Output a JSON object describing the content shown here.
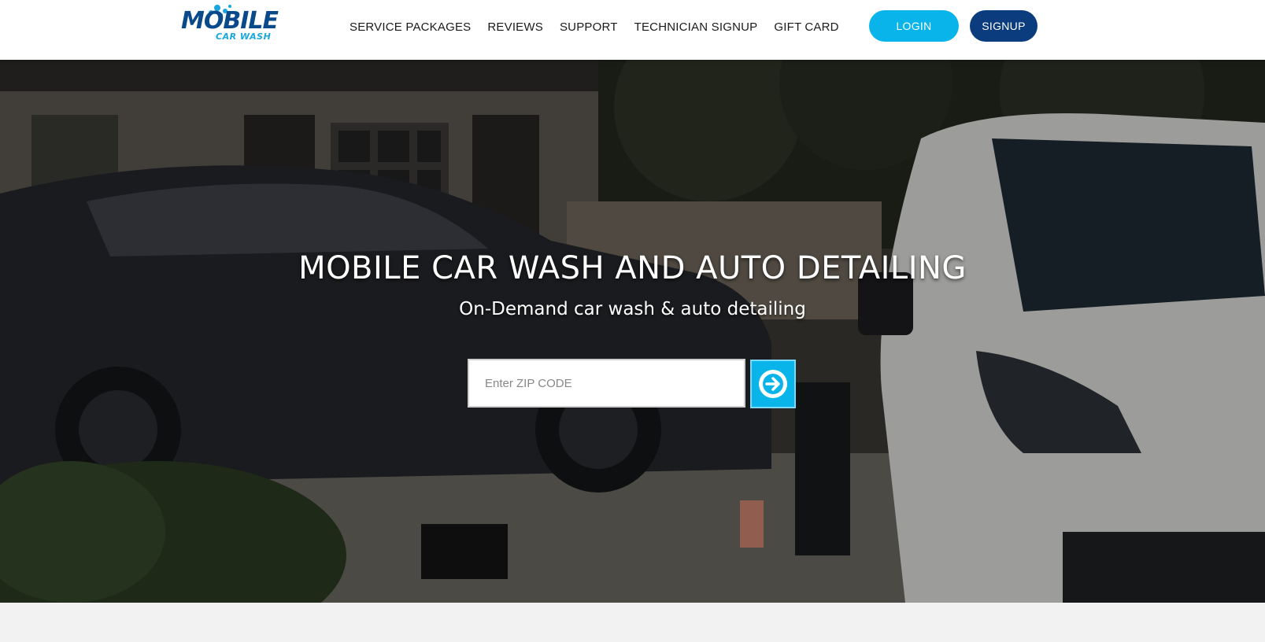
{
  "logo": {
    "word": "MOBILE",
    "sub": "CAR WASH"
  },
  "nav": {
    "items": [
      {
        "label": "SERVICE PACKAGES"
      },
      {
        "label": "REVIEWS"
      },
      {
        "label": "SUPPORT"
      },
      {
        "label": "TECHNICIAN SIGNUP"
      },
      {
        "label": "GIFT CARD"
      }
    ]
  },
  "auth": {
    "login_label": "LOGIN",
    "signup_label": "SIGNUP"
  },
  "hero": {
    "title": "MOBILE CAR WASH AND AUTO DETAILING",
    "subtitle": "On-Demand car wash & auto detailing",
    "zip_placeholder": "Enter ZIP CODE",
    "zip_value": "",
    "submit_icon": "arrow-right-circle-icon"
  },
  "colors": {
    "brand_dark": "#0b3d7e",
    "brand_light": "#08b4ea",
    "logo_text": "#0a4a8a"
  }
}
